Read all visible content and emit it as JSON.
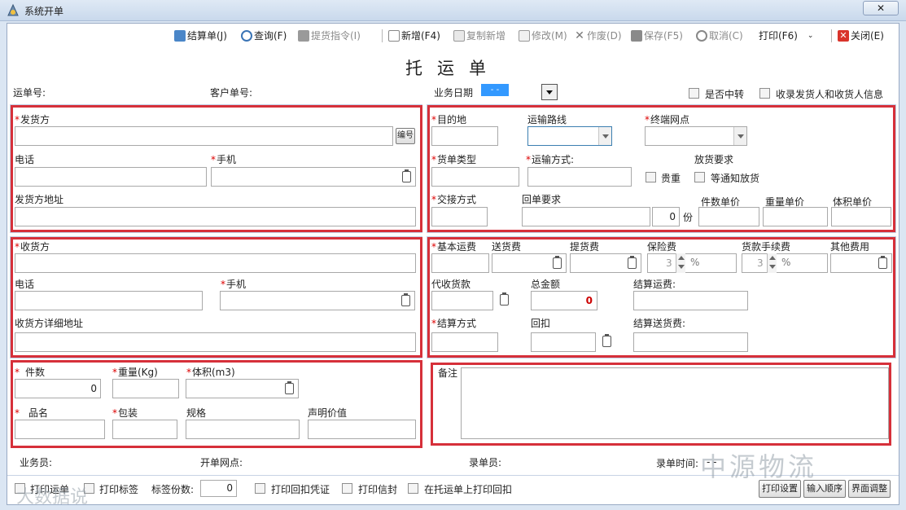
{
  "window": {
    "title": "系统开单",
    "close": "✕"
  },
  "toolbar": {
    "settle": "结算单(J)",
    "query": "查询(F)",
    "pickup_cmd": "提货指令(I)",
    "new": "新增(F4)",
    "copy_new": "复制新增",
    "modify": "修改(M)",
    "void": "作废(D)",
    "save": "保存(F5)",
    "cancel": "取消(C)",
    "print": "打印(F6)",
    "close": "关闭(E)"
  },
  "doc_title": "托运单",
  "header": {
    "waybill_no": "运单号:",
    "customer_no": "客户单号:",
    "biz_date": "业务日期",
    "biz_date_value": "-   -",
    "transfer": "是否中转",
    "collect_info": "收录发货人和收货人信息"
  },
  "shipper": {
    "title": "发货方",
    "code_btn": "编号",
    "phone": "电话",
    "mobile": "手机",
    "address": "发货方地址"
  },
  "receiver": {
    "title": "收货方",
    "phone": "电话",
    "mobile": "手机",
    "address": "收货方详细地址"
  },
  "destination": {
    "dest": "目的地",
    "route": "运输路线",
    "terminal": "终端网点",
    "doc_type": "货单类型",
    "transport": "运输方式:",
    "release_req": "放货要求",
    "valuable": "贵重",
    "wait_notice": "等通知放货",
    "handover": "交接方式",
    "receipt_req": "回单要求",
    "copies_value": "0",
    "copies_unit": "份",
    "piece_price": "件数单价",
    "weight_price": "重量单价",
    "volume_price": "体积单价"
  },
  "fees": {
    "base": "基本运费",
    "delivery": "送货费",
    "pickup": "提货费",
    "insurance": "保险费",
    "payment_fee": "货款手续费",
    "other": "其他费用",
    "ins_rate": "3",
    "pay_rate": "3",
    "pct": "%",
    "cod": "代收货款",
    "total": "总金额",
    "total_value": "0",
    "settle_freight": "结算运费:",
    "settle_method": "结算方式",
    "rebate": "回扣",
    "settle_delivery": "结算送货费:"
  },
  "goods": {
    "pieces": "件数",
    "pieces_value": "0",
    "weight": "重量(Kg)",
    "volume": "体积(m3)",
    "name": "品名",
    "packing": "包装",
    "spec": "规格",
    "declared": "声明价值"
  },
  "remarks": {
    "label": "备注"
  },
  "footer": {
    "salesman": "业务员:",
    "branch": "开单网点:",
    "clerk": "录单员:",
    "entry_time": "录单时间:",
    "entry_time_value": "-   -"
  },
  "bottom": {
    "print_waybill": "打印运单",
    "print_label": "打印标签",
    "label_copies": "标签份数:",
    "label_copies_value": "0",
    "print_receipt": "打印回扣凭证",
    "print_envelope": "打印信封",
    "print_on_waybill": "在托运单上打印回扣",
    "btn_print_settings": "打印设置",
    "btn_input_order": "输入顺序",
    "btn_layout": "界面调整"
  },
  "watermark": {
    "text": "中源物流",
    "text2": "大数据说"
  }
}
